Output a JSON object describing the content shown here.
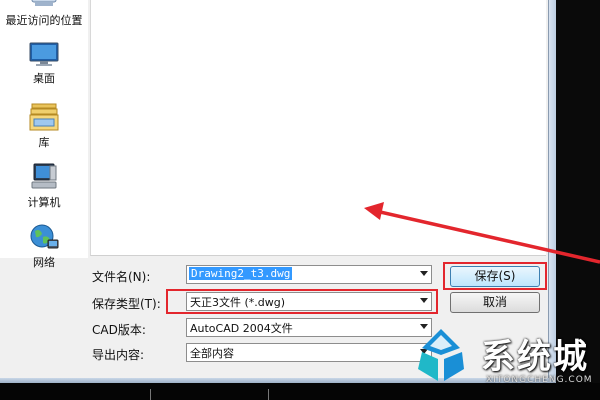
{
  "places": [
    {
      "label": "最近访问的位置",
      "icon": "recent-places-icon"
    },
    {
      "label": "桌面",
      "icon": "desktop-icon"
    },
    {
      "label": "库",
      "icon": "library-icon"
    },
    {
      "label": "计算机",
      "icon": "computer-icon"
    },
    {
      "label": "网络",
      "icon": "network-icon"
    }
  ],
  "form": {
    "file_name_label": "文件名(N):",
    "file_name_value": "Drawing2_t3.dwg",
    "file_type_label": "保存类型(T):",
    "file_type_value": "天正3文件 (*.dwg)",
    "cad_version_label": "CAD版本:",
    "cad_version_value": "AutoCAD 2004文件",
    "export_content_label": "导出内容:",
    "export_content_value": "全部内容"
  },
  "buttons": {
    "save": "保存(S)",
    "cancel": "取消"
  },
  "watermark": {
    "title": "系统城",
    "subtitle": "XITONGCHENG.COM"
  },
  "colors": {
    "highlight": "#e3262d",
    "selection": "#3399ff",
    "watermark_blue": "#1a8fd6",
    "watermark_teal": "#20b8c8"
  }
}
